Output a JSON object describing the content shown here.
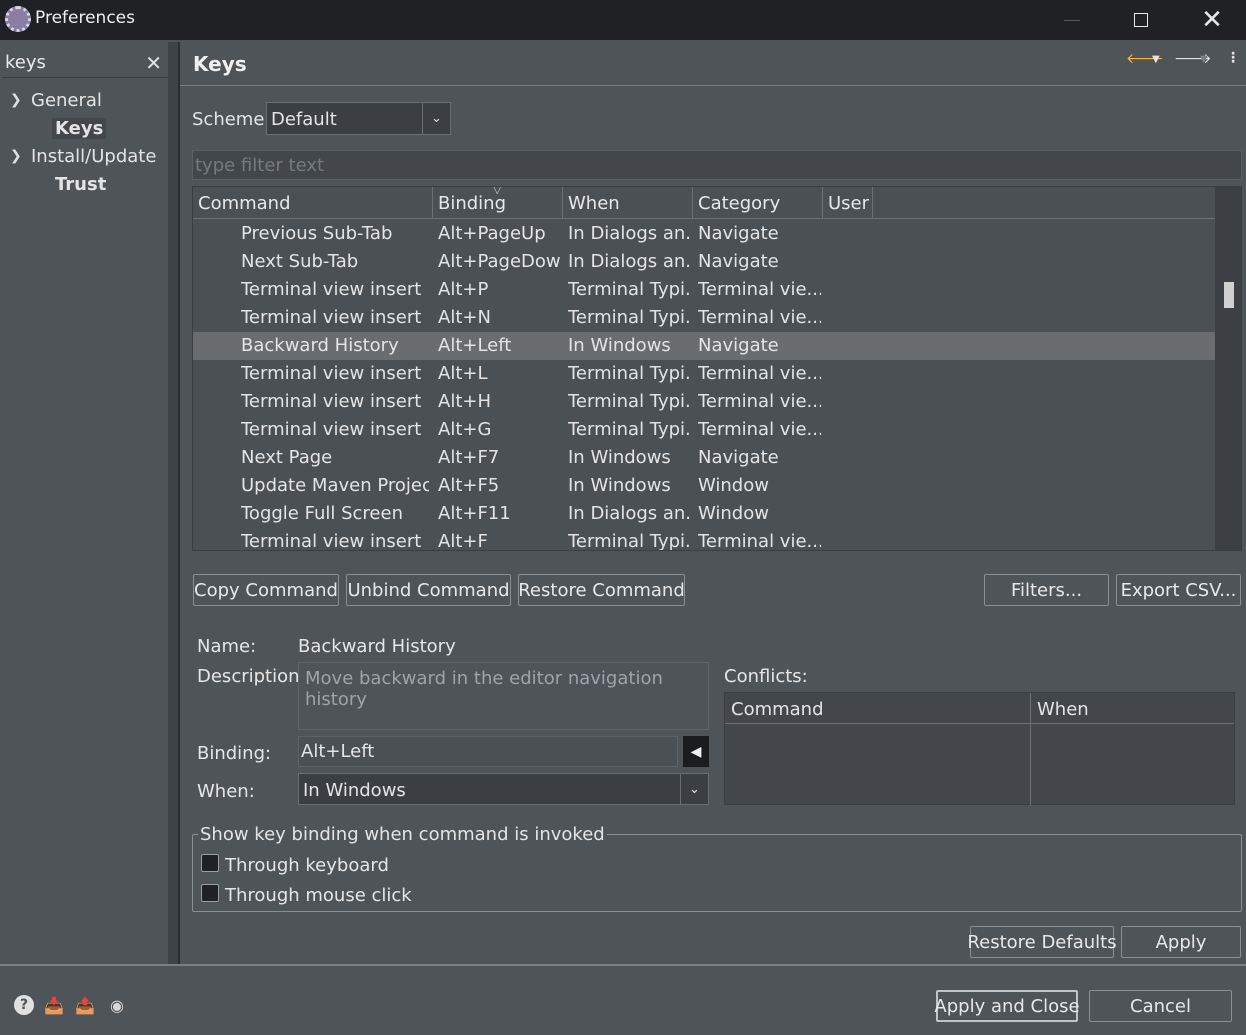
{
  "window": {
    "title": "Preferences"
  },
  "sidebar": {
    "search_value": "keys",
    "items": [
      {
        "label": "General",
        "expanded": true
      },
      {
        "label": "Keys",
        "bold": true,
        "selected": true
      },
      {
        "label": "Install/Update",
        "expanded": true
      },
      {
        "label": "Trust",
        "bold": true
      }
    ]
  },
  "page": {
    "title": "Keys",
    "scheme_label": "Scheme:",
    "scheme_value": "Default",
    "filter_placeholder": "type filter text"
  },
  "table": {
    "columns": [
      "Command",
      "Binding",
      "When",
      "Category",
      "User"
    ],
    "rows": [
      {
        "command": "Previous Sub-Tab",
        "binding": "Alt+PageUp",
        "when": "In Dialogs an...",
        "category": "Navigate",
        "user": ""
      },
      {
        "command": "Next Sub-Tab",
        "binding": "Alt+PageDown",
        "when": "In Dialogs an...",
        "category": "Navigate",
        "user": ""
      },
      {
        "command": "Terminal view insert",
        "binding": "Alt+P",
        "when": "Terminal Typi...",
        "category": "Terminal vie...",
        "user": ""
      },
      {
        "command": "Terminal view insert",
        "binding": "Alt+N",
        "when": "Terminal Typi...",
        "category": "Terminal vie...",
        "user": ""
      },
      {
        "command": "Backward History",
        "binding": "Alt+Left",
        "when": "In Windows",
        "category": "Navigate",
        "user": "",
        "selected": true
      },
      {
        "command": "Terminal view insert",
        "binding": "Alt+L",
        "when": "Terminal Typi...",
        "category": "Terminal vie...",
        "user": ""
      },
      {
        "command": "Terminal view insert",
        "binding": "Alt+H",
        "when": "Terminal Typi...",
        "category": "Terminal vie...",
        "user": ""
      },
      {
        "command": "Terminal view insert",
        "binding": "Alt+G",
        "when": "Terminal Typi...",
        "category": "Terminal vie...",
        "user": ""
      },
      {
        "command": "Next Page",
        "binding": "Alt+F7",
        "when": "In Windows",
        "category": "Navigate",
        "user": ""
      },
      {
        "command": "Update Maven Project",
        "binding": "Alt+F5",
        "when": "In Windows",
        "category": "Window",
        "user": ""
      },
      {
        "command": "Toggle Full Screen",
        "binding": "Alt+F11",
        "when": "In Dialogs an...",
        "category": "Window",
        "user": ""
      },
      {
        "command": "Terminal view insert",
        "binding": "Alt+F",
        "when": "Terminal Typi...",
        "category": "Terminal vie...",
        "user": ""
      }
    ]
  },
  "buttons": {
    "copy": "Copy Command",
    "unbind": "Unbind Command",
    "restore": "Restore Command",
    "filters": "Filters...",
    "export": "Export CSV...",
    "restore_defaults": "Restore Defaults",
    "apply": "Apply",
    "apply_close": "Apply and Close",
    "cancel": "Cancel"
  },
  "details": {
    "name_label": "Name:",
    "name_value": "Backward History",
    "description_label": "Description:",
    "description_value": "Move backward in the editor navigation history",
    "binding_label": "Binding:",
    "binding_value": "Alt+Left",
    "when_label": "When:",
    "when_value": "In Windows",
    "conflicts_label": "Conflicts:",
    "conflicts_columns": [
      "Command",
      "When"
    ]
  },
  "show_binding": {
    "legend": "Show key binding when command is invoked",
    "through_keyboard": "Through keyboard",
    "through_keyboard_checked": false,
    "through_mouse": "Through mouse click",
    "through_mouse_checked": false
  },
  "icons": {
    "help": "help-icon",
    "import": "import-icon",
    "export": "export-icon",
    "oomph": "preference-recorder-icon"
  }
}
